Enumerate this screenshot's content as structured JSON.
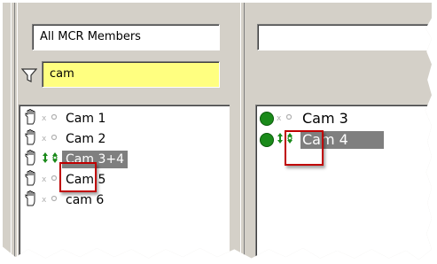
{
  "left_panel": {
    "group_value": "All MCR Members",
    "filter_value": "cam",
    "items": [
      {
        "label": "Cam 1",
        "selected": false,
        "mode": "idle"
      },
      {
        "label": "Cam 2",
        "selected": false,
        "mode": "idle"
      },
      {
        "label": "Cam 3+4",
        "selected": true,
        "mode": "arrows"
      },
      {
        "label": "Cam 5",
        "selected": false,
        "mode": "idle"
      },
      {
        "label": "cam 6",
        "selected": false,
        "mode": "idle"
      }
    ]
  },
  "right_panel": {
    "search_value": "",
    "items": [
      {
        "label": "Cam 3",
        "selected": false,
        "mode": "idle"
      },
      {
        "label": "Cam 4",
        "selected": true,
        "mode": "arrows"
      }
    ]
  },
  "icons": {
    "item_handle": "hand-icon",
    "filter": "funnel-icon",
    "status": "green-dot-icon",
    "control_idle": "tally-idle-icon",
    "control_active": "up-down-arrows-icon"
  },
  "colors": {
    "panel": "#d4d0c8",
    "filter_highlight": "#ffff80",
    "selection": "#7f7f7f",
    "callout": "#c00000",
    "status_green": "#1a8a1a"
  }
}
